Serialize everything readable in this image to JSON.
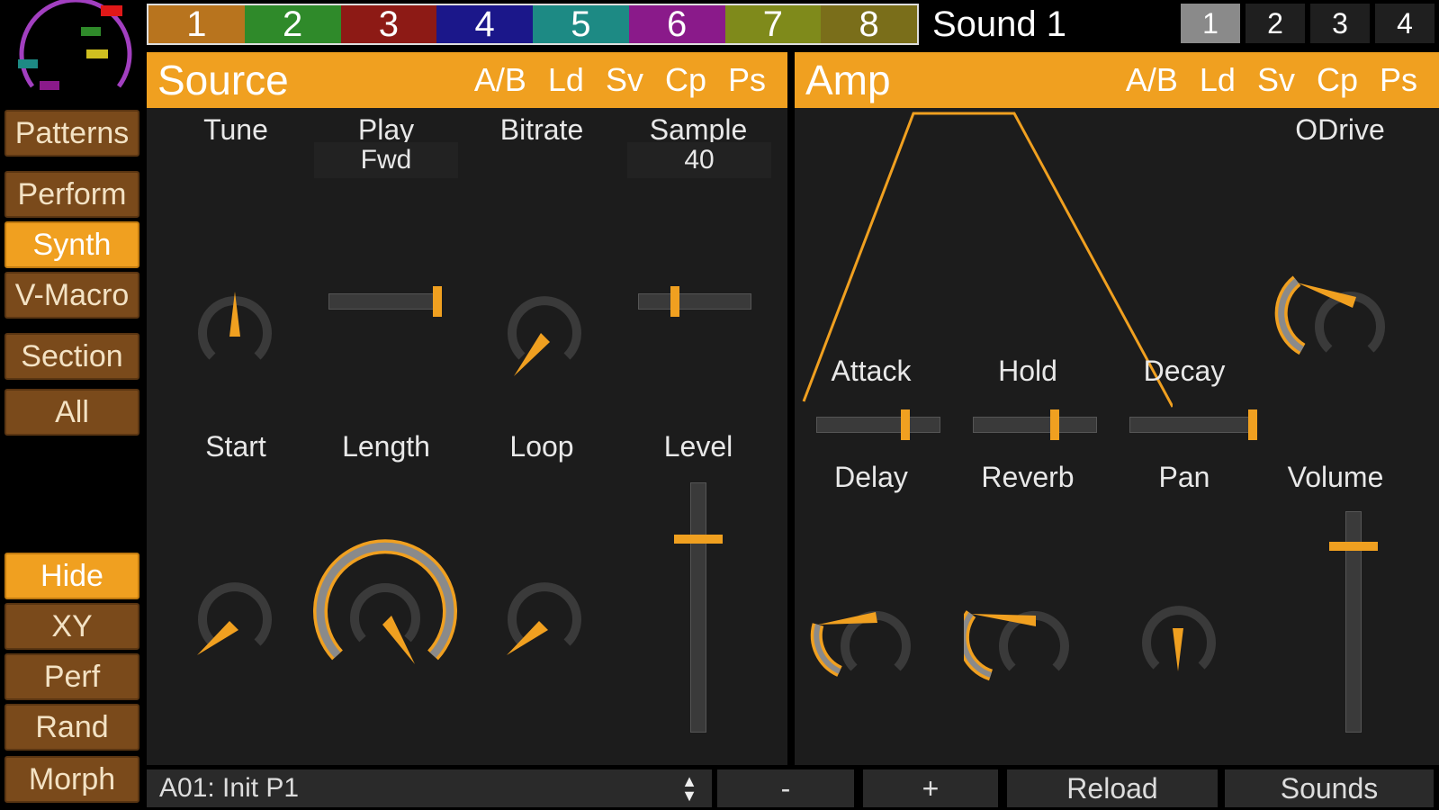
{
  "colors": {
    "accent": "#f0a020",
    "nav_inactive": "#7a4a1b",
    "panel_bg": "#1c1c1c"
  },
  "nav": {
    "patterns": "Patterns",
    "perform": "Perform",
    "synth": "Synth",
    "vmacro": "V-Macro",
    "section": "Section",
    "all": "All",
    "hide": "Hide",
    "xy": "XY",
    "perf": "Perf",
    "rand": "Rand",
    "morph": "Morph"
  },
  "tracks": [
    {
      "label": "1",
      "color": "#b8741e"
    },
    {
      "label": "2",
      "color": "#2f8a2a"
    },
    {
      "label": "3",
      "color": "#8d1a15"
    },
    {
      "label": "4",
      "color": "#1b178a"
    },
    {
      "label": "5",
      "color": "#1d8a84"
    },
    {
      "label": "6",
      "color": "#8a1a8a"
    },
    {
      "label": "7",
      "color": "#7f8a1b"
    },
    {
      "label": "8",
      "color": "#7a6e1a"
    }
  ],
  "sound_title": "Sound 1",
  "selectors": [
    "1",
    "2",
    "3",
    "4"
  ],
  "source": {
    "title": "Source",
    "buttons": [
      "A/B",
      "Ld",
      "Sv",
      "Cp",
      "Ps"
    ],
    "tune": "Tune",
    "play": "Play",
    "play_value": "Fwd",
    "bitrate": "Bitrate",
    "sample": "Sample",
    "sample_value": "40",
    "start": "Start",
    "length": "Length",
    "loop": "Loop",
    "level": "Level",
    "play_slider_fraction": 0.95,
    "sample_slider_fraction": 0.32,
    "level_slider_fraction": 0.79
  },
  "amp": {
    "title": "Amp",
    "buttons": [
      "A/B",
      "Ld",
      "Sv",
      "Cp",
      "Ps"
    ],
    "odrive": "ODrive",
    "attack": "Attack",
    "hold": "Hold",
    "decay": "Decay",
    "delay": "Delay",
    "reverb": "Reverb",
    "pan": "Pan",
    "volume": "Volume",
    "attack_fraction": 0.7,
    "hold_fraction": 0.65,
    "decay_fraction": 0.96,
    "volume_fraction": 0.86
  },
  "bottom": {
    "preset": "A01: Init P1",
    "minus": "-",
    "plus": "+",
    "reload": "Reload",
    "sounds": "Sounds"
  }
}
